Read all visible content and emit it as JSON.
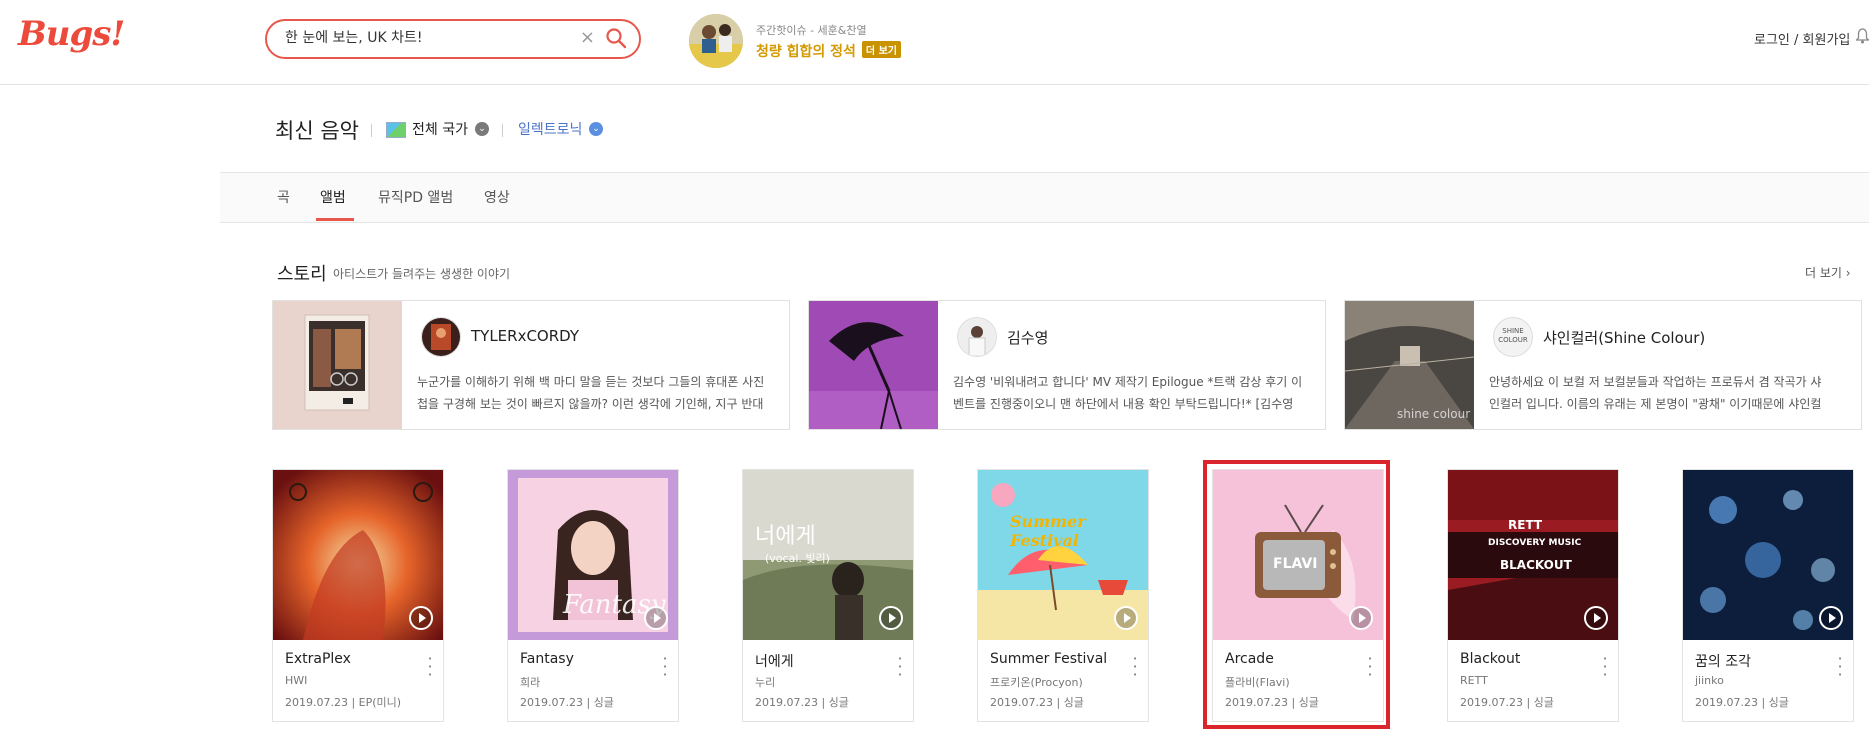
{
  "header": {
    "logo": "Bugs!",
    "search_value": "한 눈에 보는, UK 차트!",
    "clear_glyph": "×",
    "promo_subtitle": "주간핫이슈 - 세훈&찬열",
    "promo_title": "청량 힙합의 정석",
    "promo_more": "더 보기",
    "login": "로그인 / 회원가입",
    "icons": [
      "search-icon",
      "close-icon",
      "bell-icon"
    ]
  },
  "page": {
    "title": "최신 음악",
    "country": "전체 국가",
    "genre": "일렉트로닉",
    "chevron": "⌄"
  },
  "tabs": [
    "곡",
    "앨범",
    "뮤직PD 앨범",
    "영상"
  ],
  "active_tab": "앨범",
  "story": {
    "title": "스토리",
    "subtitle": "아티스트가 들려주는 생생한 이야기",
    "more": "더 보기 ›",
    "cards": [
      {
        "name": "TYLERxCORDY",
        "line1": "누군가를 이해하기 위해 백 마디 말을 듣는 것보다 그들의 휴대폰 사진",
        "line2": "첩을 구경해 보는 것이 빠르지 않을까? 이런 생각에 기인해, 지구 반대"
      },
      {
        "name": "김수영",
        "line1": "김수영 '비워내려고 합니다' MV 제작기 Epilogue *트랙 감상 후기 이",
        "line2": "벤트를 진행중이오니 맨 하단에서 내용 확인 부탁드립니다!* [김수영"
      },
      {
        "name": "샤인컬러(Shine Colour)",
        "line1": "안녕하세요 이 보컬 저 보컬분들과 작업하는 프로듀서 겸 작곡가 샤",
        "line2": "인컬러 입니다. 이름의 유래는 제 본명이 \"광채\" 이기때문에 샤인컬"
      }
    ]
  },
  "albums": [
    {
      "title": "ExtraPlex",
      "artist": "HWI",
      "meta": "2019.07.23 | EP(미니)"
    },
    {
      "title": "Fantasy",
      "artist": "희라",
      "meta": "2019.07.23 | 싱글"
    },
    {
      "title": "너에게",
      "artist": "누리",
      "meta": "2019.07.23 | 싱글"
    },
    {
      "title": "Summer Festival",
      "artist": "프로키온(Procyon)",
      "meta": "2019.07.23 | 싱글"
    },
    {
      "title": "Arcade",
      "artist": "플라비(Flavi)",
      "meta": "2019.07.23 | 싱글"
    },
    {
      "title": "Blackout",
      "artist": "RETT",
      "meta": "2019.07.23 | 싱글"
    },
    {
      "title": "꿈의 조각",
      "artist": "jiinko",
      "meta": "2019.07.23 | 싱글"
    }
  ],
  "art_text": {
    "fantasy": "Fantasy",
    "neoege": "너에게",
    "neoege_sub": "(vocal. 빛리)",
    "summer": "Summer Festival",
    "arcade_tv": "FLAVI",
    "blackout_1": "RETT",
    "blackout_2": "DISCOVERY MUSIC",
    "blackout_3": "BLACKOUT",
    "shine_logo": "SHINE COLOUR",
    "shine_watermark": "shine colour"
  },
  "colors": {
    "brand": "#ec4b3c",
    "highlight": "#d9252b",
    "promo_gold": "#d49a00",
    "genre_blue": "#4a73c9"
  }
}
